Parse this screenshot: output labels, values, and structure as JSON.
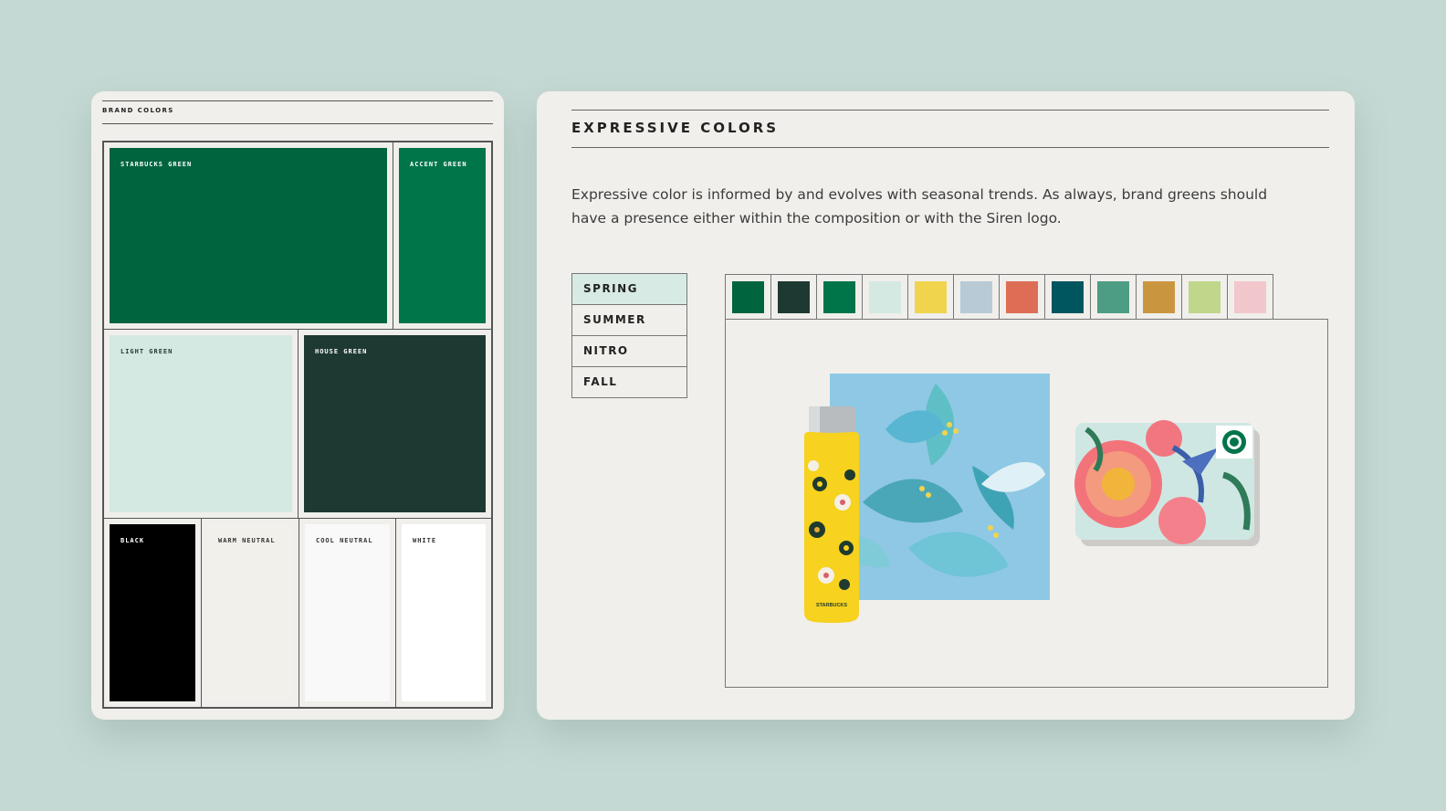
{
  "brand_colors": {
    "title": "BRAND COLORS",
    "swatches": [
      {
        "label": "STARBUCKS GREEN",
        "color": "#00643f",
        "text_color": "#ffffff"
      },
      {
        "label": "ACCENT GREEN",
        "color": "#00754a",
        "text_color": "#ffffff"
      },
      {
        "label": "LIGHT GREEN",
        "color": "#d4e9e2",
        "text_color": "#1e3932"
      },
      {
        "label": "HOUSE GREEN",
        "color": "#1e3932",
        "text_color": "#ffffff"
      },
      {
        "label": "BLACK",
        "color": "#000000",
        "text_color": "#ffffff"
      },
      {
        "label": "WARM NEUTRAL",
        "color": "#f2f0eb",
        "text_color": "#333333"
      },
      {
        "label": "COOL NEUTRAL",
        "color": "#f9f9f9",
        "text_color": "#333333"
      },
      {
        "label": "WHITE",
        "color": "#ffffff",
        "text_color": "#333333"
      }
    ]
  },
  "expressive": {
    "title": "EXPRESSIVE COLORS",
    "description": "Expressive color is informed by and evolves with seasonal trends. As always, brand greens should have a presence either within the composition or with the Siren logo.",
    "tabs": [
      "SPRING",
      "SUMMER",
      "NITRO",
      "FALL"
    ],
    "active_tab": "SPRING",
    "palette": [
      "#00643f",
      "#1e3932",
      "#00754a",
      "#d4e9e2",
      "#f0d44e",
      "#b8cad6",
      "#dd6e55",
      "#00565f",
      "#4d9d84",
      "#c9963f",
      "#c0d68a",
      "#f2c7cc"
    ],
    "preview": {
      "bottle_brand": "STARBUCKS"
    }
  }
}
